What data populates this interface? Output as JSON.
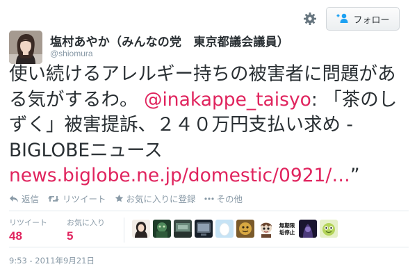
{
  "header": {
    "display_name": "塩村あやか（みんなの党　東京都議会議員）",
    "screen_name": "@shiomura",
    "follow_label": "フォロー"
  },
  "tweet": {
    "text_before": "使い続けるアレルギー持ちの被害者に問題がある気がするわ。 ",
    "mention": "@inakappe_taisyo",
    "text_middle": ": 「茶のしずく」被害提訴、２４０万円支払い求め - BIGLOBEニュース ",
    "link": "news.biglobe.ne.jp/domestic/0921/…",
    "text_after": "”"
  },
  "actions": {
    "reply": "返信",
    "retweet": "リツイート",
    "favorite": "お気に入りに登録",
    "more": "その他"
  },
  "stats": {
    "retweets_label": "リツイート",
    "retweets_value": "48",
    "favorites_label": "お気に入り",
    "favorites_value": "5"
  },
  "faces_text": {
    "face8": "無期限\n垢停止"
  },
  "timestamp": "9:53 - 2011年9月21日",
  "colors": {
    "accent": "#e0245e",
    "muted": "#8899a6",
    "text": "#292f33"
  }
}
